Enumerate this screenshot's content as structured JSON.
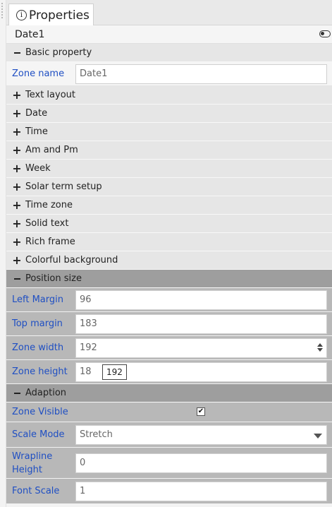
{
  "tab": {
    "label": "Properties",
    "icon": "info-icon"
  },
  "object": {
    "name": "Date1"
  },
  "sections": {
    "basic": "Basic property",
    "text_layout": "Text layout",
    "date": "Date",
    "time": "Time",
    "am_pm": "Am and Pm",
    "week": "Week",
    "solar_term": "Solar term setup",
    "time_zone": "Time zone",
    "solid_text": "Solid text",
    "rich_frame": "Rich frame",
    "colorful_bg": "Colorful background",
    "position_size": "Position size",
    "adaption": "Adaption"
  },
  "basic": {
    "zone_name_label": "Zone name",
    "zone_name_value": "Date1"
  },
  "position": {
    "left_margin_label": "Left Margin",
    "left_margin_value": "96",
    "top_margin_label": "Top margin",
    "top_margin_value": "183",
    "zone_width_label": "Zone width",
    "zone_width_value": "192",
    "zone_height_label": "Zone height",
    "zone_height_value": "18",
    "tooltip_value": "192"
  },
  "adaption": {
    "zone_visible_label": "Zone Visible",
    "zone_visible_checked": "✔",
    "scale_mode_label": "Scale Mode",
    "scale_mode_value": "Stretch",
    "wrapline_label": "Wrapline Height",
    "wrapline_value": "0",
    "font_scale_label": "Font Scale",
    "font_scale_value": "1"
  },
  "colors": {
    "label_blue": "#1f4fc3",
    "section_dark": "#9e9e9e",
    "row_gray": "#b8b8b8"
  }
}
